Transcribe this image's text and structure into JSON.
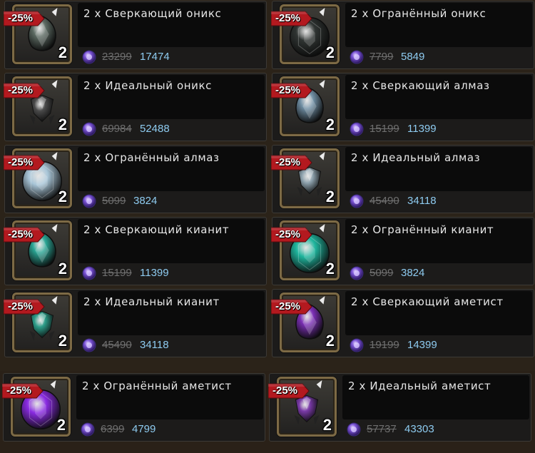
{
  "discount_label": "-25%",
  "items": [
    {
      "title": "2 x Сверкающий оникс",
      "quantity": "2",
      "old_price": "23299",
      "new_price": "17474",
      "gem": "onyx-sparkling-icon",
      "color": "#5c6a62"
    },
    {
      "title": "2 x Огранённый оникс",
      "quantity": "2",
      "old_price": "7799",
      "new_price": "5849",
      "gem": "onyx-cut-icon",
      "color": "#2f3432"
    },
    {
      "title": "2 x Идеальный оникс",
      "quantity": "2",
      "old_price": "69984",
      "new_price": "52488",
      "gem": "onyx-perfect-icon",
      "color": "#4a4a4a"
    },
    {
      "title": "2 x Сверкающий алмаз",
      "quantity": "2",
      "old_price": "15199",
      "new_price": "11399",
      "gem": "diamond-sparkling-icon",
      "color": "#6f8ea3"
    },
    {
      "title": "2 x Огранённый алмаз",
      "quantity": "2",
      "old_price": "5099",
      "new_price": "3824",
      "gem": "diamond-cut-icon",
      "color": "#a9c6d8"
    },
    {
      "title": "2 x Идеальный алмаз",
      "quantity": "2",
      "old_price": "45490",
      "new_price": "34118",
      "gem": "diamond-perfect-icon",
      "color": "#8ea2ad"
    },
    {
      "title": "2 x Сверкающий кианит",
      "quantity": "2",
      "old_price": "15199",
      "new_price": "11399",
      "gem": "kyanite-sparkling-icon",
      "color": "#2aa594"
    },
    {
      "title": "2 x Огранённый кианит",
      "quantity": "2",
      "old_price": "5099",
      "new_price": "3824",
      "gem": "kyanite-cut-icon",
      "color": "#1fb59d"
    },
    {
      "title": "2 x Идеальный кианит",
      "quantity": "2",
      "old_price": "45490",
      "new_price": "34118",
      "gem": "kyanite-perfect-icon",
      "color": "#2c9c88"
    },
    {
      "title": "2 x Сверкающий аметист",
      "quantity": "2",
      "old_price": "19199",
      "new_price": "14399",
      "gem": "amethyst-sparkling-icon",
      "color": "#7b2fb5"
    },
    {
      "title": "2 x Огранённый аметист",
      "quantity": "2",
      "old_price": "6399",
      "new_price": "4799",
      "gem": "amethyst-cut-icon",
      "color": "#8a2be2"
    },
    {
      "title": "2 x Идеальный аметист",
      "quantity": "2",
      "old_price": "57737",
      "new_price": "43303",
      "gem": "amethyst-perfect-icon",
      "color": "#7a3aa8"
    }
  ],
  "colors": {
    "old_price": "#6f6f6f",
    "new_price": "#8ecbf0",
    "discount_badge": "#b3191f",
    "card_bg": "#1c1b1a"
  }
}
